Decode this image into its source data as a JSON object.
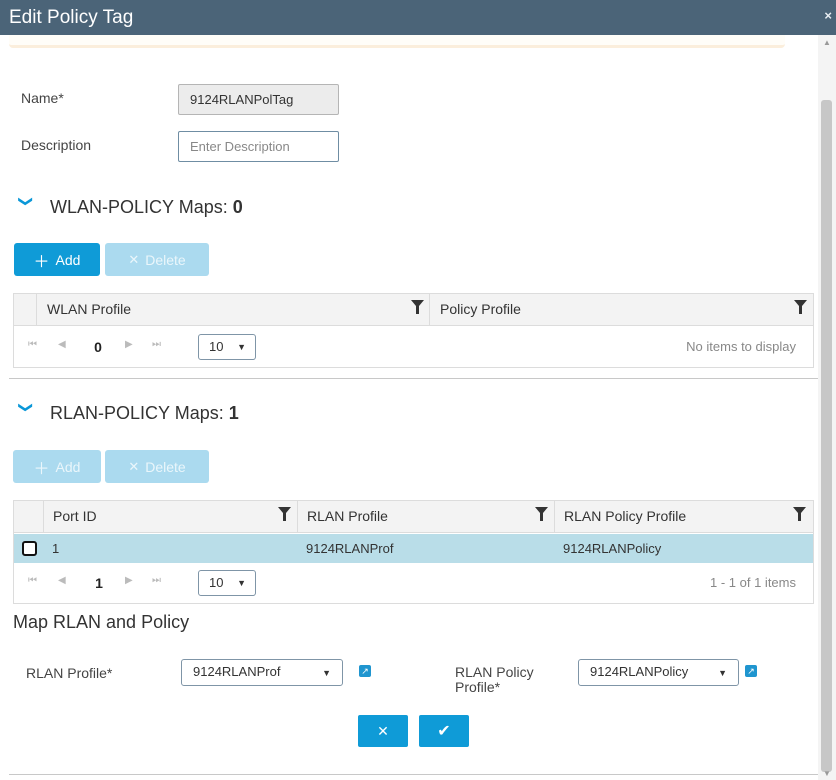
{
  "dialog": {
    "title": "Edit Policy Tag",
    "close_glyph": "×"
  },
  "form": {
    "name_label": "Name*",
    "name_value": "9124RLANPolTag",
    "description_label": "Description",
    "description_placeholder": "Enter Description"
  },
  "wlan_section": {
    "title": "WLAN-POLICY Maps:",
    "count": "0",
    "add_label": "Add",
    "delete_label": "Delete",
    "columns": [
      "WLAN Profile",
      "Policy Profile"
    ],
    "pager": {
      "page": "0",
      "page_size": "10",
      "info": "No items to display"
    }
  },
  "rlan_section": {
    "title": "RLAN-POLICY Maps:",
    "count": "1",
    "add_label": "Add",
    "delete_label": "Delete",
    "columns": [
      "Port ID",
      "RLAN Profile",
      "RLAN Policy Profile"
    ],
    "rows": [
      {
        "port_id": "1",
        "rlan_profile": "9124RLANProf",
        "rlan_policy_profile": "9124RLANPolicy"
      }
    ],
    "pager": {
      "page": "1",
      "page_size": "10",
      "info": "1 - 1 of 1 items"
    }
  },
  "map_section": {
    "title": "Map RLAN and Policy",
    "rlan_profile_label": "RLAN Profile*",
    "rlan_profile_value": "9124RLANProf",
    "rlan_policy_label_1": "RLAN Policy",
    "rlan_policy_label_2": "Profile*",
    "rlan_policy_value": "9124RLANPolicy"
  },
  "icons": {
    "plus": "＋",
    "cross": "✕",
    "chevron": "❯",
    "first": "⏮",
    "prev": "◀",
    "next": "▶",
    "last": "⏭",
    "caret": "▼",
    "check": "✔",
    "external": "↗"
  },
  "colors": {
    "titlebar": "#4b6478",
    "primary": "#0f9bd7",
    "selected_row": "#b9dde8"
  }
}
